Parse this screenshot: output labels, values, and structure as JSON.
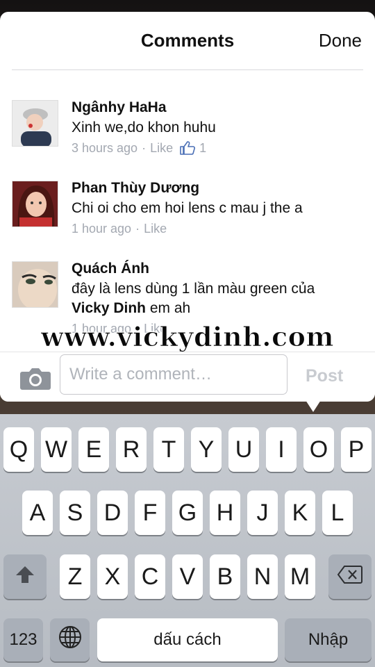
{
  "header": {
    "title": "Comments",
    "done_label": "Done"
  },
  "comments": [
    {
      "name": "Ngânhy HaHa",
      "text": "Xinh we,do khon huhu",
      "time": "3 hours ago",
      "like_label": "Like",
      "like_count": "1"
    },
    {
      "name": "Phan Thùy Dương",
      "text": "Chi oi cho em hoi lens c mau j the a",
      "time": "1 hour ago",
      "like_label": "Like"
    },
    {
      "name": "Quách Ánh",
      "text": "đây là lens dùng 1 lần màu green của",
      "mention": "Vicky Dinh",
      "text_suffix": " em ah",
      "time": "1 hour ago",
      "like_label": "Like"
    }
  ],
  "watermark": "www.vickydinh.com",
  "composer": {
    "placeholder": "Write a comment…",
    "post_label": "Post",
    "camera_icon": "camera-icon"
  },
  "keyboard": {
    "row1": [
      "Q",
      "W",
      "E",
      "R",
      "T",
      "Y",
      "U",
      "I",
      "O",
      "P"
    ],
    "row2": [
      "A",
      "S",
      "D",
      "F",
      "G",
      "H",
      "J",
      "K",
      "L"
    ],
    "row3": [
      "Z",
      "X",
      "C",
      "V",
      "B",
      "N",
      "M"
    ],
    "numbers_label": "123",
    "space_label": "dấu cách",
    "return_label": "Nhập",
    "shift_icon": "shift-icon",
    "delete_icon": "delete-icon",
    "globe_icon": "globe-icon"
  },
  "colors": {
    "meta_gray": "#a3a8b1",
    "like_blue": "#4a6fb5",
    "keyboard_bg": "#c7cbd1"
  }
}
